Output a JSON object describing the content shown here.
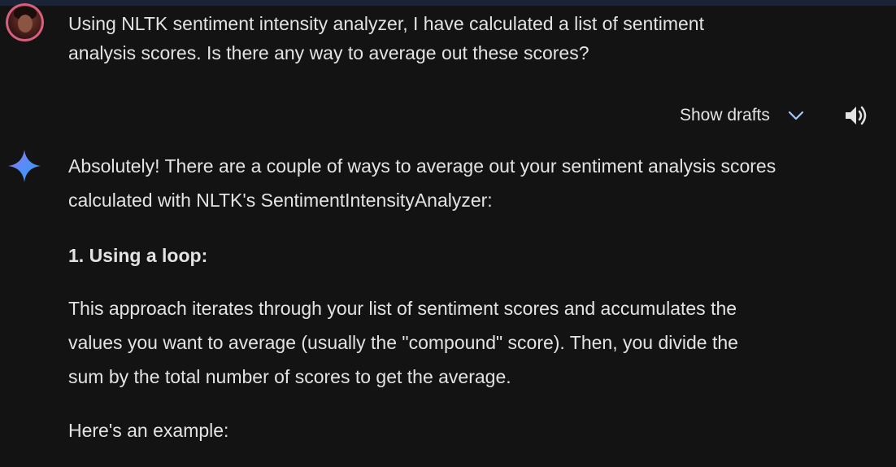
{
  "user_message": {
    "lines": [
      "Using NLTK sentiment intensity analyzer, I have calculated a list of sentiment",
      "analysis scores. Is there any way to average out these scores?"
    ]
  },
  "toolbar": {
    "show_drafts_label": "Show drafts"
  },
  "icons": {
    "chevron": "chevron-down-icon",
    "speaker": "speaker-icon",
    "gemini": "gemini-sparkle-icon",
    "avatar": "user-avatar"
  },
  "colors": {
    "background": "#131314",
    "text": "#e3e3e3",
    "top_bar": "#1b2336",
    "accent_blue": "#4f8ff7"
  },
  "response": {
    "intro_lines": [
      "Absolutely! There are a couple of ways to average out your sentiment analysis scores",
      "calculated with NLTK's SentimentIntensityAnalyzer:"
    ],
    "heading": "1. Using a loop:",
    "body_lines": [
      "This approach iterates through your list of sentiment scores and accumulates the",
      "values you want to average (usually the \"compound\" score). Then, you divide the",
      "sum by the total number of scores to get the average."
    ],
    "example_label": "Here's an example:"
  }
}
